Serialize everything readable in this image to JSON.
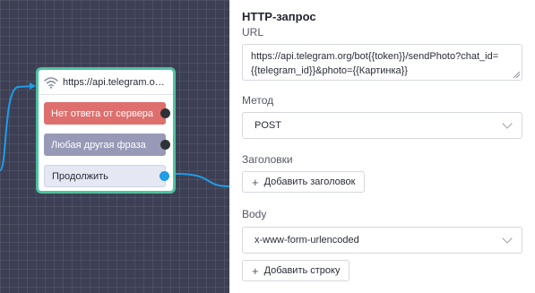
{
  "node": {
    "title": "https://api.telegram.org/...",
    "rows": [
      {
        "label": "Нет ответа от сервера"
      },
      {
        "label": "Любая другая фраза"
      },
      {
        "label": "Продолжить"
      }
    ]
  },
  "panel": {
    "title": "HTTP-запрос",
    "url_label": "URL",
    "url_value": "https://api.telegram.org/bot{{token}}/sendPhoto?chat_id={{telegram_id}}&photo={{Картинка}}",
    "method_label": "Метод",
    "method_value": "POST",
    "headers_label": "Заголовки",
    "add_header_label": "Добавить заголовок",
    "body_label": "Body",
    "body_type_value": "x-www-form-urlencoded",
    "add_row_label": "Добавить строку"
  },
  "colors": {
    "node_border": "#4ec3a0",
    "row_red": "#de6f6d",
    "row_gray": "#9799b7",
    "connector_blue": "#1f9de8"
  }
}
